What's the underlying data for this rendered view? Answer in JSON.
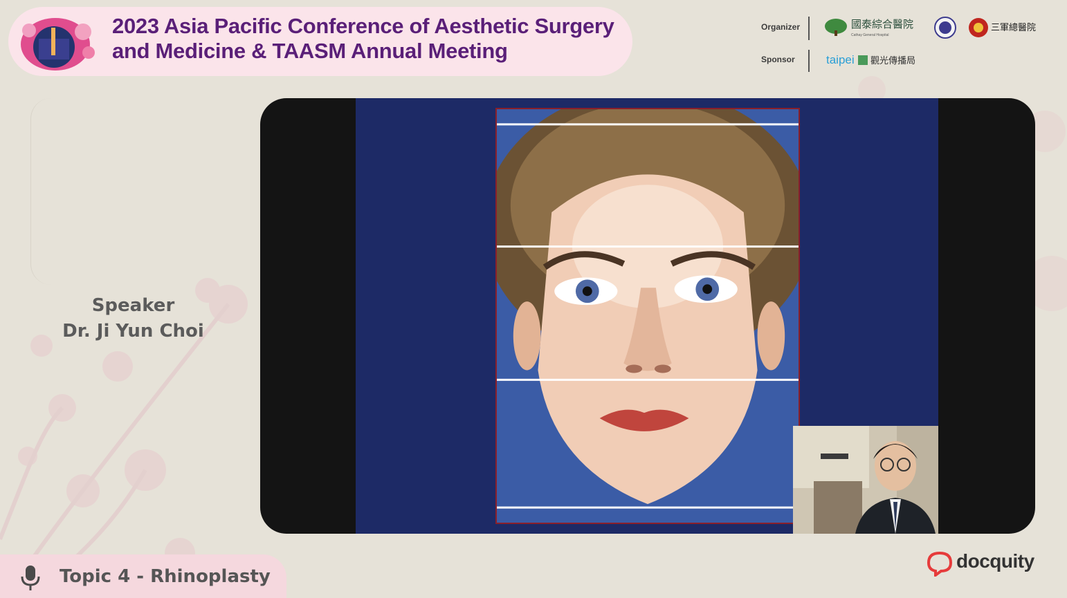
{
  "header": {
    "title_line1": "2023 Asia Pacific Conference of Aesthetic Surgery",
    "title_line2": "and Medicine & TAASM Annual Meeting",
    "organizer_label": "Organizer",
    "sponsor_label": "Sponsor",
    "organizer_hospital": "國泰綜合醫院",
    "organizer_hospital_en": "Cathay General Hospital",
    "organizer_third": "三軍總醫院",
    "sponsor_taipei": "taipei",
    "sponsor_bureau": "觀光傳播局"
  },
  "speaker": {
    "label": "Speaker",
    "name": "Dr. Ji Yun Choi"
  },
  "topic": {
    "text": "Topic 4 - Rhinoplasty"
  },
  "brand": {
    "name": "docquity"
  },
  "colors": {
    "title": "#5a1f78",
    "pill": "#fbe4ea",
    "slide_blue": "#1d2a66",
    "brand_red": "#e63b3b"
  }
}
